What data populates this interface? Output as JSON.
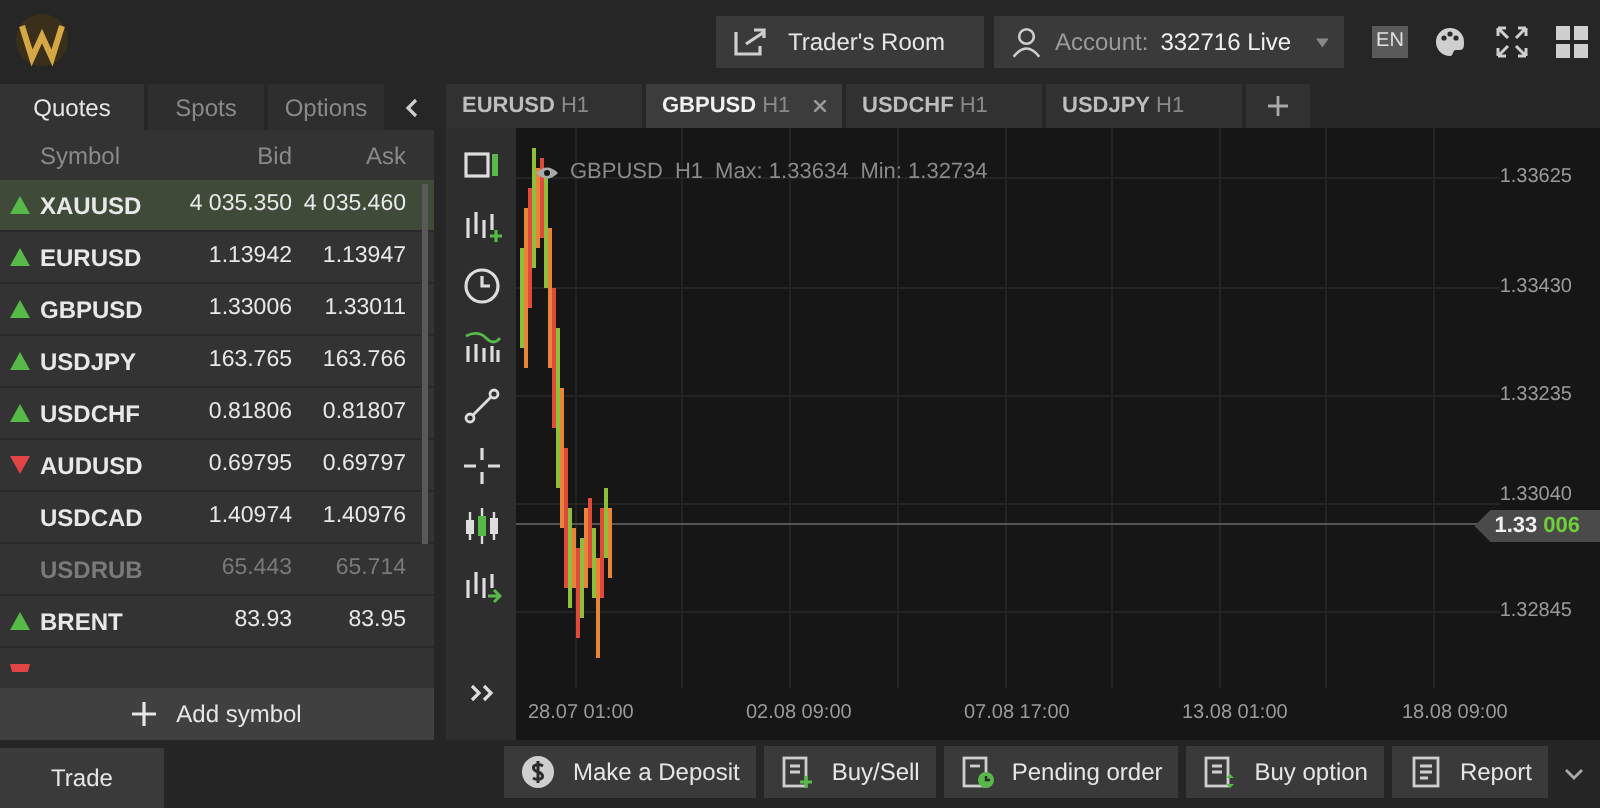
{
  "header": {
    "traders_room": "Trader's Room",
    "account_label": "Account:",
    "account_value": "332716 Live",
    "language": "EN"
  },
  "panel_tabs": [
    {
      "label": "Quotes",
      "selected": true
    },
    {
      "label": "Spots",
      "selected": false
    },
    {
      "label": "Options",
      "selected": false
    }
  ],
  "quotes": {
    "columns": [
      "Symbol",
      "Bid",
      "Ask"
    ],
    "rows": [
      {
        "symbol": "XAUUSD",
        "bid": "4 035.350",
        "ask": "4 035.460",
        "kind": "up",
        "selected": true,
        "disabled": false
      },
      {
        "symbol": "EURUSD",
        "bid": "1.13942",
        "ask": "1.13947",
        "kind": "up",
        "selected": false,
        "disabled": false
      },
      {
        "symbol": "GBPUSD",
        "bid": "1.33006",
        "ask": "1.33011",
        "kind": "up",
        "selected": false,
        "disabled": false
      },
      {
        "symbol": "USDJPY",
        "bid": "163.765",
        "ask": "163.766",
        "kind": "up",
        "selected": false,
        "disabled": false
      },
      {
        "symbol": "USDCHF",
        "bid": "0.81806",
        "ask": "0.81807",
        "kind": "up",
        "selected": false,
        "disabled": false
      },
      {
        "symbol": "AUDUSD",
        "bid": "0.69795",
        "ask": "0.69797",
        "kind": "down",
        "selected": false,
        "disabled": false
      },
      {
        "symbol": "USDCAD",
        "bid": "1.40974",
        "ask": "1.40976",
        "kind": "flat",
        "selected": false,
        "disabled": false
      },
      {
        "symbol": "USDRUB",
        "bid": "65.443",
        "ask": "65.714",
        "kind": "flat",
        "selected": false,
        "disabled": true
      },
      {
        "symbol": "BRENT",
        "bid": "83.93",
        "ask": "83.95",
        "kind": "up",
        "selected": false,
        "disabled": false
      }
    ],
    "add_button": "Add symbol"
  },
  "chart_tabs": [
    {
      "symbol": "EURUSD",
      "timeframe": "H1",
      "selected": false
    },
    {
      "symbol": "GBPUSD",
      "timeframe": "H1",
      "selected": true
    },
    {
      "symbol": "USDCHF",
      "timeframe": "H1",
      "selected": false
    },
    {
      "symbol": "USDJPY",
      "timeframe": "H1",
      "selected": false
    }
  ],
  "chart": {
    "symbol": "GBPUSD",
    "timeframe": "H1",
    "max": "Max: 1.33634",
    "min": "Min: 1.32734",
    "y_labels": [
      "1.33625",
      "1.33430",
      "1.33235",
      "1.33040",
      "1.32845"
    ],
    "x_labels": [
      "28.07 01:00",
      "02.08 09:00",
      "07.08 17:00",
      "13.08 01:00",
      "18.08 09:00"
    ],
    "price_main": "1.33",
    "price_tail": "006"
  },
  "bottom": {
    "tab": "Trade",
    "buttons": [
      {
        "kind": "deposit",
        "label": "Make a Deposit"
      },
      {
        "kind": "buysell",
        "label": "Buy/Sell"
      },
      {
        "kind": "pending",
        "label": "Pending order"
      },
      {
        "kind": "option",
        "label": "Buy option"
      },
      {
        "kind": "report",
        "label": "Report"
      }
    ]
  }
}
